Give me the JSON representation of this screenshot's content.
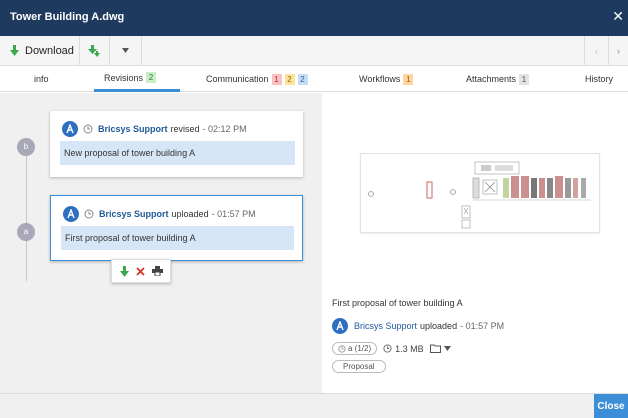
{
  "window": {
    "title": "Tower Building A.dwg"
  },
  "toolbar": {
    "download_label": "Download"
  },
  "tabs": [
    {
      "label": "info"
    },
    {
      "label": "Revisions",
      "badges": [
        "2"
      ]
    },
    {
      "label": "Communication",
      "badges": [
        "1",
        "2",
        "2"
      ]
    },
    {
      "label": "Workflows",
      "badges": [
        "1"
      ]
    },
    {
      "label": "Attachments",
      "badges": [
        "1"
      ]
    },
    {
      "label": "History"
    }
  ],
  "revisions": [
    {
      "marker": "b",
      "author": "Bricsys Support",
      "action": "revised",
      "time": "- 02:12 PM",
      "comment": "New proposal of tower building A"
    },
    {
      "marker": "a",
      "author": "Bricsys Support",
      "action": "uploaded",
      "time": "- 01:57 PM",
      "comment": "First proposal of tower building A"
    }
  ],
  "preview": {
    "caption": "First proposal of tower building A",
    "author": "Bricsys Support",
    "action": "uploaded",
    "time": "- 01:57 PM",
    "version_label": "a (1/2)",
    "size": "1.3 MB",
    "tag": "Proposal"
  },
  "footer": {
    "close_label": "Close"
  },
  "colors": {
    "titlebar": "#1f3a5f",
    "accent": "#3c8fd6",
    "selected_comment_bg": "#d6e6f7",
    "download_green": "#3aa84a",
    "delete_red": "#d9342b"
  }
}
